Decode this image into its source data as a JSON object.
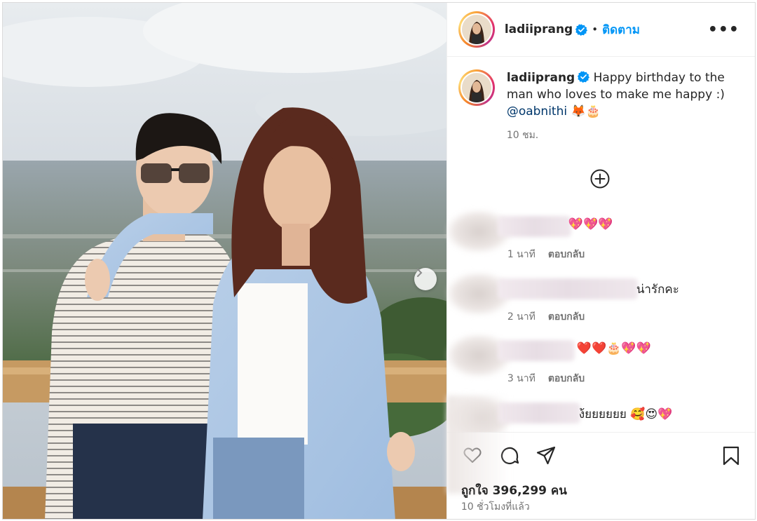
{
  "header": {
    "username": "ladiiprang",
    "separator": "•",
    "follow_label": "ติดตาม",
    "more_label": "•••",
    "avatar_icon": "profile-avatar",
    "verified_icon": "verified-badge-icon"
  },
  "caption": {
    "username": "ladiiprang",
    "text": "Happy birthday to the man who loves to make me happy :)",
    "mention": "@oabnithi",
    "emojis": "🦊🎂",
    "time": "10 ชม."
  },
  "load_more_icon": "plus-circle-icon",
  "comments": [
    {
      "text": "💖💖💖",
      "time": "1 นาที",
      "reply_label": "ตอบกลับ"
    },
    {
      "text": "น่ารักคะ",
      "time": "2 นาที",
      "reply_label": "ตอบกลับ"
    },
    {
      "text": "❤️❤️🎂💖💖",
      "time": "3 นาที",
      "reply_label": "ตอบกลับ"
    },
    {
      "text": "ง้ยยยยยย 🥰😍💖"
    }
  ],
  "actions": {
    "icons": [
      "heart-icon",
      "comment-icon",
      "share-icon",
      "bookmark-icon"
    ]
  },
  "likes": "ถูกใจ 396,299 คน",
  "post_time": "10 ชั่วโมงที่แล้ว",
  "colors": {
    "follow": "#0095f6",
    "mention": "#00376b",
    "secondary_text": "#737373",
    "border": "#dbdbdb"
  }
}
